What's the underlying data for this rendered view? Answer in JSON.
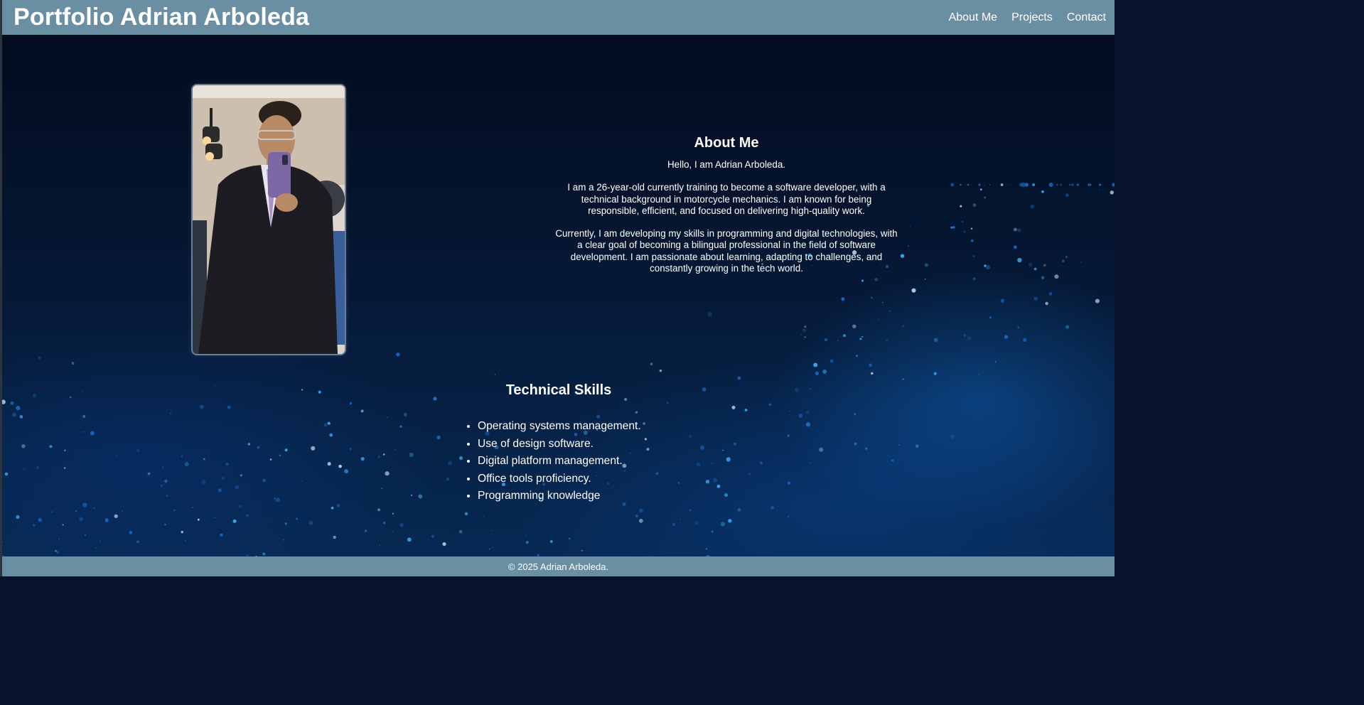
{
  "header": {
    "title": "Portfolio Adrian Arboleda",
    "nav": [
      {
        "label": "About Me"
      },
      {
        "label": "Projects"
      },
      {
        "label": "Contact"
      }
    ]
  },
  "about": {
    "heading": "About Me",
    "greeting": "Hello, I am Adrian Arboleda.",
    "paragraph1": "I am a 26-year-old currently training to become a software developer, with a technical background in motorcycle mechanics. I am known for being responsible, efficient, and focused on delivering high-quality work.",
    "paragraph2": "Currently, I am developing my skills in programming and digital technologies, with a clear goal of becoming a bilingual professional in the field of software development. I am passionate about learning, adapting to challenges, and constantly growing in the tech world."
  },
  "skills": {
    "heading": "Technical Skills",
    "items": [
      "Operating systems management.",
      "Use of design software.",
      "Digital platform management.",
      "Office tools proficiency.",
      "Programming knowledge"
    ]
  },
  "footer": {
    "text": "© 2025 Adrian Arboleda."
  },
  "colors": {
    "bar": "#6a8ea2",
    "background": "#06132a",
    "text": "#ffffff"
  }
}
